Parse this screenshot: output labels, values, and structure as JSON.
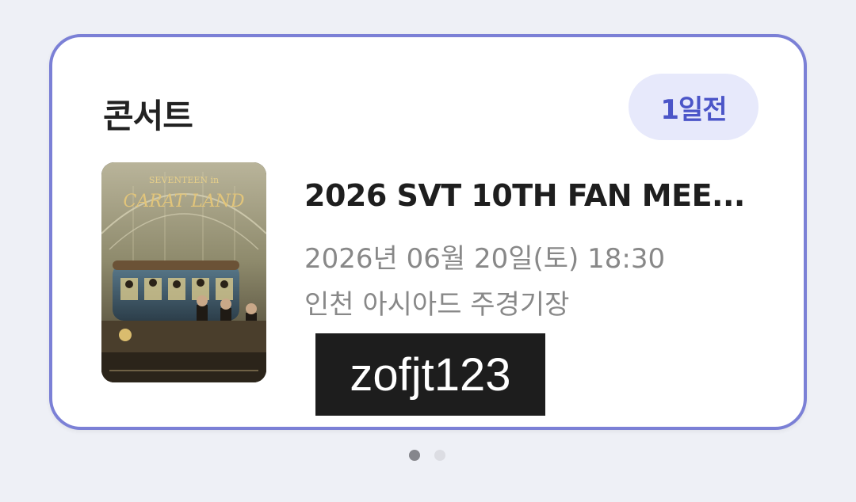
{
  "card": {
    "category": "콘서트",
    "badge": "1일전",
    "title": "2026 SVT 10TH FAN MEE...",
    "datetime": "2026년 06월 20일(토) 18:30",
    "venue": "인천 아시아드 주경기장",
    "watermark": "zofjt123",
    "poster": {
      "line1": "SEVENTEEN in",
      "line2": "CARAT LAND"
    }
  },
  "pagination": {
    "total": 2,
    "active_index": 0
  },
  "colors": {
    "border": "#7b80d6",
    "badge_bg": "#e7e9fb",
    "badge_text": "#4b55c8",
    "background": "#eef0f6"
  }
}
